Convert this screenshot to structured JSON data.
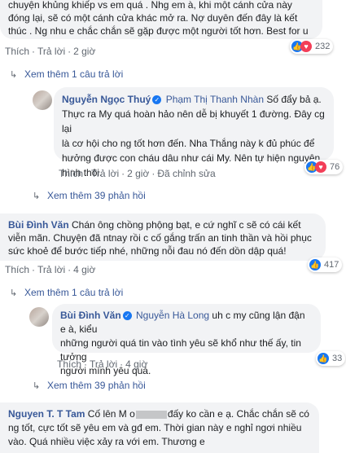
{
  "c1": {
    "lines": [
      "chuyện khủng khiếp vs em quá . Nhg em à, khi một cánh cửa này",
      "đóng lại, sẽ có một cánh cửa khác mở ra. Nợ duyên đến đây là kết",
      "thúc . Ng nhu e chắc chắn sẽ gặp được một người tốt hơn. Best for u"
    ],
    "like": "Thích",
    "reply": "Trả lời",
    "time": "2 giờ",
    "reactions": "232"
  },
  "c1_more": "Xem thêm 1 câu trả lời",
  "r1": {
    "name": "Nguyễn Ngọc Thuý",
    "tag": "Phạm Thị Thanh Nhàn",
    "first": " Số đẩy bả ạ.",
    "lines": [
      "Thực ra My quá hoàn hảo nên dễ bị khuyết 1 đường. Đây cg lại",
      "là cơ hội cho ng tốt hơn đến. Nha Thắng này k đủ phúc để",
      "hưởng được con cháu dâu như cái My. Nên tự hiện nguyên",
      "hình thôi."
    ],
    "like": "Thích",
    "reply": "Trả lời",
    "time": "2 giờ",
    "edited": "Đã chỉnh sửa",
    "reactions": "76"
  },
  "r1_more": "Xem thêm 39 phản hồi",
  "c2": {
    "name": "Bùi Đình Văn",
    "first": " Chán ông chồng phộng bạt, e cứ nghĩ c sẽ có cái kết",
    "lines": [
      "viễn mãn. Chuyện đã ntnay rồi c cố gắng trấn an tinh thần và hồi phục",
      "sức khoẻ để bước tiếp nhé, những nỗi đau nó đến dồn dập quá!"
    ],
    "like": "Thích",
    "reply": "Trả lời",
    "time": "4 giờ",
    "reactions": "417"
  },
  "c2_more": "Xem thêm 1 câu trả lời",
  "r2": {
    "name": "Bùi Đình Văn",
    "tag": "Nguyễn Hà Long",
    "first": " uh c my cũng lận đận e à, kiểu",
    "lines": [
      "những người quá tin vào tình yêu sẽ khổ như thế ấy, tin tưởng",
      "người mình yêu quá."
    ],
    "like": "Thích",
    "reply": "Trả lời",
    "time": "4 giờ",
    "reactions": "33"
  },
  "r2_more": "Xem thêm 39 phản hồi",
  "c3": {
    "name": "Nguyen T. T Tam",
    "first_a": " Cố lên M o",
    "first_b": "đấy ko cần e ạ. Chắc chắn sẽ có",
    "lines": [
      "ng tốt, cực tốt sẽ yêu em và gđ em. Thời gian này e nghỉ ngơi nhiều",
      "vào. Quá nhiều việc xảy ra với em. Thương e"
    ]
  },
  "icons": {
    "like": "like-icon",
    "love": "love-icon",
    "reply_arrow": "reply-arrow-icon",
    "verified": "verified-badge-icon"
  },
  "colors": {
    "link": "#385898",
    "bubble": "#f2f3f5",
    "meta": "#606770"
  }
}
